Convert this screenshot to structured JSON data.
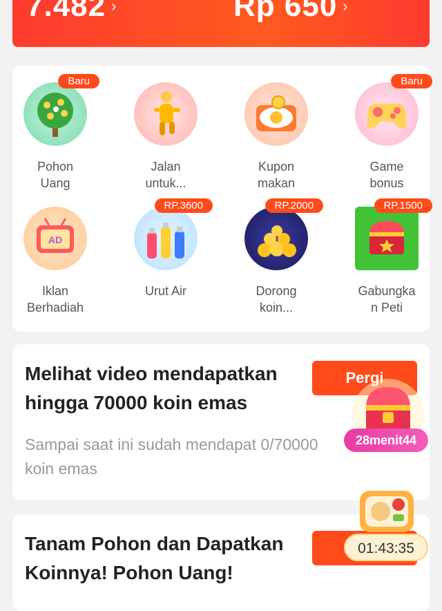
{
  "header": {
    "coins_value": "7.482",
    "cash_value": "Rp 650",
    "chevron": "›"
  },
  "games": [
    {
      "label": "Pohon\nUang",
      "badge": "Baru",
      "icon": "money-tree-icon"
    },
    {
      "label": "Jalan\nuntuk...",
      "badge": "",
      "icon": "runner-icon"
    },
    {
      "label": "Kupon\nmakan",
      "badge": "",
      "icon": "food-coupon-icon"
    },
    {
      "label": "Game\nbonus",
      "badge": "Baru",
      "icon": "gamepad-icon"
    },
    {
      "label": "Iklan\nBerhadiah",
      "badge": "",
      "icon": "ad-tv-icon"
    },
    {
      "label": "Urut Air",
      "badge": "RP.3600",
      "icon": "water-bottles-icon"
    },
    {
      "label": "Dorong\nkoin...",
      "badge": "RP.2000",
      "icon": "coin-pusher-icon"
    },
    {
      "label": "Gabungka\nn Peti",
      "badge": "RP.1500",
      "icon": "treasure-chest-icon"
    }
  ],
  "task_video": {
    "title": "Melihat video mendapatkan hingga 70000 koin emas",
    "subtitle": "Sampai saat ini sudah mendapat 0/70000 koin emas",
    "button": "Pergi"
  },
  "task_tree": {
    "title": "Tanam Pohon dan Dapatkan Koinnya! Pohon Uang!"
  },
  "floating": {
    "chest_timer": "28menit44",
    "food_timer": "01:43:35"
  },
  "colors": {
    "accent": "#ff4a1a",
    "header_gradient_start": "#ff3b2e",
    "header_gradient_end": "#ff5a1f",
    "timer_pink": "#e83aa5"
  }
}
